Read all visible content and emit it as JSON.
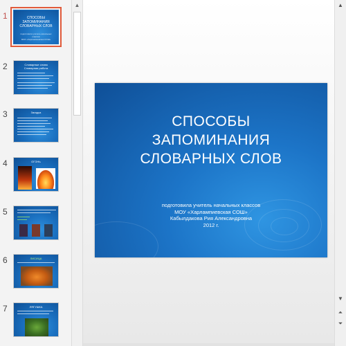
{
  "thumbnails": [
    {
      "number": "1",
      "title": "СПОСОБЫ\nЗАПОМИНАНИЯ\nСЛОВАРНЫХ СЛОВ",
      "subtitle": "подготовила учитель начальных классов\nМОУ «Харлампиевская СОШ»"
    },
    {
      "number": "2",
      "heading": "Словарные слова\nСловарная работа"
    },
    {
      "number": "3",
      "heading": "Загадка"
    },
    {
      "number": "4",
      "heading": "ОГОНЬ"
    },
    {
      "number": "5",
      "heading": ""
    },
    {
      "number": "6",
      "heading": "ЛИСИЦА"
    },
    {
      "number": "7",
      "heading": "ЛЯГУШКА"
    }
  ],
  "slide": {
    "title": "СПОСОБЫ\nЗАПОМИНАНИЯ\nСЛОВАРНЫХ  СЛОВ",
    "subtitle": "подготовила учитель начальных классов\nМОУ «Харлампиевская СОШ»\nКабылдакова Рия Александровна\n2012 г."
  },
  "icons": {
    "scroll_up": "scroll-up-icon",
    "scroll_down": "scroll-down-icon",
    "prev_slide": "previous-slide-icon",
    "next_slide": "next-slide-icon"
  },
  "colors": {
    "selection": "#e05a3a",
    "slide_blue": "#1a6fbf",
    "active_number": "#c0504d"
  }
}
